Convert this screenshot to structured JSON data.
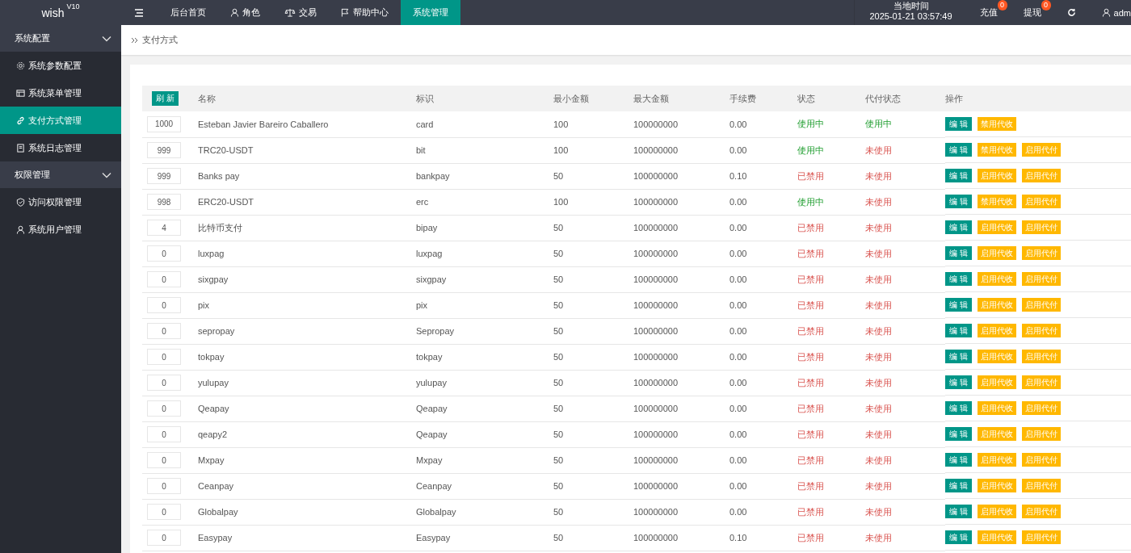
{
  "topbar": {
    "logo": "wish",
    "version": "V10",
    "nav": [
      {
        "label": "后台首页",
        "selected": false
      },
      {
        "label": "角色",
        "selected": false
      },
      {
        "label": "交易",
        "selected": false
      },
      {
        "label": "帮助中心",
        "selected": false
      },
      {
        "label": "系统管理",
        "selected": true
      }
    ],
    "clock_label": "当地时间",
    "clock": "2025-01-21 03:57:49",
    "actions": [
      {
        "label": "充值",
        "badge": "0"
      },
      {
        "label": "提现",
        "badge": "0"
      }
    ],
    "user": "adm"
  },
  "sidebar": [
    {
      "label": "系统配置",
      "expanded": true,
      "children": [
        {
          "label": "系统参数配置",
          "selected": false
        },
        {
          "label": "系统菜单管理",
          "selected": false
        },
        {
          "label": "支付方式管理",
          "selected": true
        },
        {
          "label": "系统日志管理",
          "selected": false
        }
      ]
    },
    {
      "label": "权限管理",
      "expanded": true,
      "children": [
        {
          "label": "访问权限管理",
          "selected": false
        },
        {
          "label": "系统用户管理",
          "selected": false
        }
      ]
    }
  ],
  "breadcrumb": "支付方式",
  "table": {
    "refresh": "刷 新",
    "columns": [
      "名称",
      "标识",
      "最小金额",
      "最大金额",
      "手续费",
      "状态",
      "代付状态",
      "操作"
    ],
    "rows": [
      {
        "sort": "1000",
        "name": "Esteban Javier Bareiro Caballero",
        "code": "card",
        "min": "100",
        "max": "100000000",
        "fee": "0.00",
        "status": {
          "text": "使用中",
          "on": true
        },
        "payout": {
          "text": "使用中",
          "on": true
        },
        "buttons": [
          {
            "label": "编 辑",
            "kind": "edit"
          },
          {
            "label": "禁用代收",
            "kind": "warn"
          }
        ]
      },
      {
        "sort": "999",
        "name": "TRC20-USDT",
        "code": "bit",
        "min": "100",
        "max": "100000000",
        "fee": "0.00",
        "status": {
          "text": "使用中",
          "on": true
        },
        "payout": {
          "text": "未使用",
          "on": false
        },
        "buttons": [
          {
            "label": "编 辑",
            "kind": "edit"
          },
          {
            "label": "禁用代收",
            "kind": "warn"
          },
          {
            "label": "启用代付",
            "kind": "warn"
          }
        ]
      },
      {
        "sort": "999",
        "name": "Banks pay",
        "code": "bankpay",
        "min": "50",
        "max": "100000000",
        "fee": "0.10",
        "status": {
          "text": "已禁用",
          "on": false
        },
        "payout": {
          "text": "未使用",
          "on": false
        },
        "buttons": [
          {
            "label": "编 辑",
            "kind": "edit"
          },
          {
            "label": "启用代收",
            "kind": "warn"
          },
          {
            "label": "启用代付",
            "kind": "warn"
          }
        ]
      },
      {
        "sort": "998",
        "name": "ERC20-USDT",
        "code": "erc",
        "min": "100",
        "max": "100000000",
        "fee": "0.00",
        "status": {
          "text": "使用中",
          "on": true
        },
        "payout": {
          "text": "未使用",
          "on": false
        },
        "buttons": [
          {
            "label": "编 辑",
            "kind": "edit"
          },
          {
            "label": "禁用代收",
            "kind": "warn"
          },
          {
            "label": "启用代付",
            "kind": "warn"
          }
        ]
      },
      {
        "sort": "4",
        "name": "比特币支付",
        "code": "bipay",
        "min": "50",
        "max": "100000000",
        "fee": "0.00",
        "status": {
          "text": "已禁用",
          "on": false
        },
        "payout": {
          "text": "未使用",
          "on": false
        },
        "buttons": [
          {
            "label": "编 辑",
            "kind": "edit"
          },
          {
            "label": "启用代收",
            "kind": "warn"
          },
          {
            "label": "启用代付",
            "kind": "warn"
          }
        ]
      },
      {
        "sort": "0",
        "name": "luxpag",
        "code": "luxpag",
        "min": "50",
        "max": "100000000",
        "fee": "0.00",
        "status": {
          "text": "已禁用",
          "on": false
        },
        "payout": {
          "text": "未使用",
          "on": false
        },
        "buttons": [
          {
            "label": "编 辑",
            "kind": "edit"
          },
          {
            "label": "启用代收",
            "kind": "warn"
          },
          {
            "label": "启用代付",
            "kind": "warn"
          }
        ]
      },
      {
        "sort": "0",
        "name": "sixgpay",
        "code": "sixgpay",
        "min": "50",
        "max": "100000000",
        "fee": "0.00",
        "status": {
          "text": "已禁用",
          "on": false
        },
        "payout": {
          "text": "未使用",
          "on": false
        },
        "buttons": [
          {
            "label": "编 辑",
            "kind": "edit"
          },
          {
            "label": "启用代收",
            "kind": "warn"
          },
          {
            "label": "启用代付",
            "kind": "warn"
          }
        ]
      },
      {
        "sort": "0",
        "name": "pix",
        "code": "pix",
        "min": "50",
        "max": "100000000",
        "fee": "0.00",
        "status": {
          "text": "已禁用",
          "on": false
        },
        "payout": {
          "text": "未使用",
          "on": false
        },
        "buttons": [
          {
            "label": "编 辑",
            "kind": "edit"
          },
          {
            "label": "启用代收",
            "kind": "warn"
          },
          {
            "label": "启用代付",
            "kind": "warn"
          }
        ]
      },
      {
        "sort": "0",
        "name": "sepropay",
        "code": "Sepropay",
        "min": "50",
        "max": "100000000",
        "fee": "0.00",
        "status": {
          "text": "已禁用",
          "on": false
        },
        "payout": {
          "text": "未使用",
          "on": false
        },
        "buttons": [
          {
            "label": "编 辑",
            "kind": "edit"
          },
          {
            "label": "启用代收",
            "kind": "warn"
          },
          {
            "label": "启用代付",
            "kind": "warn"
          }
        ]
      },
      {
        "sort": "0",
        "name": "tokpay",
        "code": "tokpay",
        "min": "50",
        "max": "100000000",
        "fee": "0.00",
        "status": {
          "text": "已禁用",
          "on": false
        },
        "payout": {
          "text": "未使用",
          "on": false
        },
        "buttons": [
          {
            "label": "编 辑",
            "kind": "edit"
          },
          {
            "label": "启用代收",
            "kind": "warn"
          },
          {
            "label": "启用代付",
            "kind": "warn"
          }
        ]
      },
      {
        "sort": "0",
        "name": "yulupay",
        "code": "yulupay",
        "min": "50",
        "max": "100000000",
        "fee": "0.00",
        "status": {
          "text": "已禁用",
          "on": false
        },
        "payout": {
          "text": "未使用",
          "on": false
        },
        "buttons": [
          {
            "label": "编 辑",
            "kind": "edit"
          },
          {
            "label": "启用代收",
            "kind": "warn"
          },
          {
            "label": "启用代付",
            "kind": "warn"
          }
        ]
      },
      {
        "sort": "0",
        "name": "Qeapay",
        "code": "Qeapay",
        "min": "50",
        "max": "100000000",
        "fee": "0.00",
        "status": {
          "text": "已禁用",
          "on": false
        },
        "payout": {
          "text": "未使用",
          "on": false
        },
        "buttons": [
          {
            "label": "编 辑",
            "kind": "edit"
          },
          {
            "label": "启用代收",
            "kind": "warn"
          },
          {
            "label": "启用代付",
            "kind": "warn"
          }
        ]
      },
      {
        "sort": "0",
        "name": "qeapy2",
        "code": "Qeapay",
        "min": "50",
        "max": "100000000",
        "fee": "0.00",
        "status": {
          "text": "已禁用",
          "on": false
        },
        "payout": {
          "text": "未使用",
          "on": false
        },
        "buttons": [
          {
            "label": "编 辑",
            "kind": "edit"
          },
          {
            "label": "启用代收",
            "kind": "warn"
          },
          {
            "label": "启用代付",
            "kind": "warn"
          }
        ]
      },
      {
        "sort": "0",
        "name": "Mxpay",
        "code": "Mxpay",
        "min": "50",
        "max": "100000000",
        "fee": "0.00",
        "status": {
          "text": "已禁用",
          "on": false
        },
        "payout": {
          "text": "未使用",
          "on": false
        },
        "buttons": [
          {
            "label": "编 辑",
            "kind": "edit"
          },
          {
            "label": "启用代收",
            "kind": "warn"
          },
          {
            "label": "启用代付",
            "kind": "warn"
          }
        ]
      },
      {
        "sort": "0",
        "name": "Ceanpay",
        "code": "Ceanpay",
        "min": "50",
        "max": "100000000",
        "fee": "0.00",
        "status": {
          "text": "已禁用",
          "on": false
        },
        "payout": {
          "text": "未使用",
          "on": false
        },
        "buttons": [
          {
            "label": "编 辑",
            "kind": "edit"
          },
          {
            "label": "启用代收",
            "kind": "warn"
          },
          {
            "label": "启用代付",
            "kind": "warn"
          }
        ]
      },
      {
        "sort": "0",
        "name": "Globalpay",
        "code": "Globalpay",
        "min": "50",
        "max": "100000000",
        "fee": "0.00",
        "status": {
          "text": "已禁用",
          "on": false
        },
        "payout": {
          "text": "未使用",
          "on": false
        },
        "buttons": [
          {
            "label": "编 辑",
            "kind": "edit"
          },
          {
            "label": "启用代收",
            "kind": "warn"
          },
          {
            "label": "启用代付",
            "kind": "warn"
          }
        ]
      },
      {
        "sort": "0",
        "name": "Easypay",
        "code": "Easypay",
        "min": "50",
        "max": "100000000",
        "fee": "0.10",
        "status": {
          "text": "已禁用",
          "on": false
        },
        "payout": {
          "text": "未使用",
          "on": false
        },
        "buttons": [
          {
            "label": "编 辑",
            "kind": "edit"
          },
          {
            "label": "启用代收",
            "kind": "warn"
          },
          {
            "label": "启用代付",
            "kind": "warn"
          }
        ]
      }
    ]
  }
}
